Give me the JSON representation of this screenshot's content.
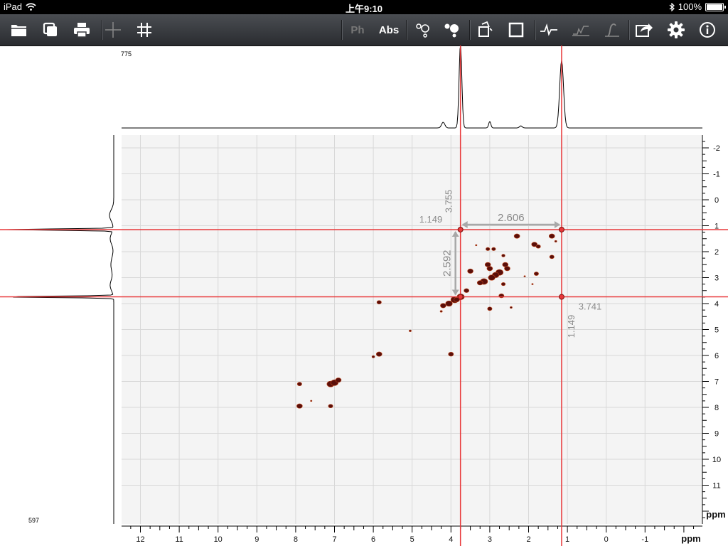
{
  "status_bar": {
    "device": "iPad",
    "time": "上午9:10",
    "battery": "100%"
  },
  "toolbar": {
    "buttons": [
      {
        "name": "open-folder-icon"
      },
      {
        "name": "copy-icon"
      },
      {
        "name": "print-icon"
      },
      {
        "name": "crosshair-icon"
      },
      {
        "name": "grid-icon"
      },
      {
        "name": "phase-button",
        "label": "Ph"
      },
      {
        "name": "absolute-button",
        "label": "Abs"
      },
      {
        "name": "peak-pick-icon"
      },
      {
        "name": "peak-pick-filled-icon"
      },
      {
        "name": "rotate-box-icon"
      },
      {
        "name": "square-icon"
      },
      {
        "name": "spectrum-line-icon"
      },
      {
        "name": "integral-icon"
      },
      {
        "name": "integral-curve-icon"
      },
      {
        "name": "share-icon"
      },
      {
        "name": "gear-icon"
      },
      {
        "name": "info-icon"
      }
    ]
  },
  "colors": {
    "cursor_line": "#e8383a",
    "peak": "#5a0f0a",
    "measure": "#a8a8a8",
    "plot_bg": "#f4f4f4",
    "grid": "#d8d8d8"
  },
  "top_projection_max": "775",
  "left_projection_max": "597",
  "chart_data": {
    "type": "heatmap",
    "xlabel": "ppm",
    "ylabel": "ppm",
    "xlim": [
      12.5,
      -2.5
    ],
    "ylim": [
      -2.5,
      12.5
    ],
    "x_ticks": [
      12,
      11,
      10,
      9,
      8,
      7,
      6,
      5,
      4,
      3,
      2,
      1,
      0,
      -1
    ],
    "y_ticks": [
      -2,
      -1,
      0,
      1,
      2,
      3,
      4,
      5,
      6,
      7,
      8,
      9,
      10,
      11
    ],
    "cursor_x": [
      3.755,
      1.149
    ],
    "cursor_y": [
      1.149,
      3.741
    ],
    "labels": {
      "cursor_x1": "3.755",
      "cursor_y1": "1.149",
      "cursor_x2": "1.149",
      "cursor_y2": "3.741",
      "delta_horizontal": "2.606",
      "delta_vertical": "2.592"
    },
    "peaks": [
      [
        1.15,
        1.15,
        0.8
      ],
      [
        3.75,
        1.15,
        0.7
      ],
      [
        1.16,
        3.74,
        0.6
      ],
      [
        3.75,
        3.74,
        1.3
      ],
      [
        3.9,
        3.85,
        1.4
      ],
      [
        4.05,
        4.0,
        1.2
      ],
      [
        4.2,
        4.08,
        1.0
      ],
      [
        3.85,
        3.85,
        1.0
      ],
      [
        2.3,
        1.4,
        1.0
      ],
      [
        1.4,
        1.4,
        1.0
      ],
      [
        1.85,
        1.72,
        1.0
      ],
      [
        1.75,
        1.8,
        0.8
      ],
      [
        3.05,
        1.9,
        0.7
      ],
      [
        2.9,
        1.9,
        0.7
      ],
      [
        2.65,
        2.15,
        0.6
      ],
      [
        1.4,
        2.2,
        0.8
      ],
      [
        3.5,
        2.75,
        1.0
      ],
      [
        3.05,
        2.5,
        1.0
      ],
      [
        3.0,
        2.65,
        1.0
      ],
      [
        2.6,
        2.5,
        1.0
      ],
      [
        2.55,
        2.65,
        1.0
      ],
      [
        2.75,
        2.8,
        1.3
      ],
      [
        2.85,
        2.9,
        1.2
      ],
      [
        2.95,
        3.0,
        1.2
      ],
      [
        3.15,
        3.15,
        1.3
      ],
      [
        3.25,
        3.2,
        1.0
      ],
      [
        3.6,
        3.5,
        0.9
      ],
      [
        2.65,
        3.25,
        0.7
      ],
      [
        1.8,
        2.85,
        0.8
      ],
      [
        2.7,
        3.7,
        0.9
      ],
      [
        3.75,
        3.74,
        0.7
      ],
      [
        3.0,
        4.2,
        0.8
      ],
      [
        5.85,
        3.95,
        0.8
      ],
      [
        5.85,
        5.95,
        1.0
      ],
      [
        6.0,
        6.05,
        0.5
      ],
      [
        4.0,
        5.95,
        0.9
      ],
      [
        5.05,
        5.05,
        0.4
      ],
      [
        7.9,
        7.1,
        0.8
      ],
      [
        7.9,
        7.95,
        1.0
      ],
      [
        7.1,
        7.1,
        1.3
      ],
      [
        7.0,
        7.05,
        1.3
      ],
      [
        6.9,
        6.95,
        1.0
      ],
      [
        7.1,
        7.95,
        0.8
      ],
      [
        7.6,
        7.75,
        0.3
      ],
      [
        4.25,
        4.3,
        0.4
      ],
      [
        3.35,
        1.75,
        0.3
      ],
      [
        2.1,
        2.95,
        0.3
      ],
      [
        1.9,
        3.25,
        0.3
      ],
      [
        2.45,
        4.15,
        0.4
      ],
      [
        1.3,
        1.6,
        0.4
      ]
    ]
  }
}
